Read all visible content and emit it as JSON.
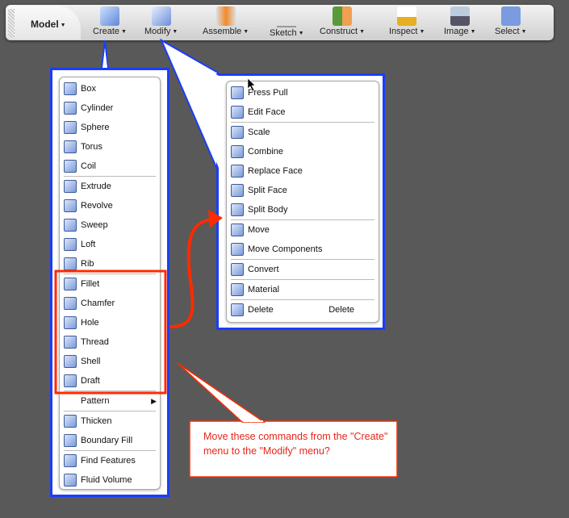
{
  "toolbar": {
    "model_label": "Model",
    "tools": [
      {
        "label": "Create",
        "icon": "box-icon"
      },
      {
        "label": "Modify",
        "icon": "press-pull-icon"
      },
      {
        "label": "Assemble",
        "icon": "assemble-icon"
      },
      {
        "label": "Sketch",
        "icon": "sketch-icon"
      },
      {
        "label": "Construct",
        "icon": "construct-icon"
      },
      {
        "label": "Inspect",
        "icon": "ruler-icon"
      },
      {
        "label": "Image",
        "icon": "image-icon"
      },
      {
        "label": "Select",
        "icon": "cursor-icon"
      }
    ]
  },
  "create_menu": {
    "groups": [
      [
        {
          "label": "Box"
        },
        {
          "label": "Cylinder"
        },
        {
          "label": "Sphere"
        },
        {
          "label": "Torus"
        },
        {
          "label": "Coil"
        }
      ],
      [
        {
          "label": "Extrude"
        },
        {
          "label": "Revolve"
        },
        {
          "label": "Sweep"
        },
        {
          "label": "Loft"
        },
        {
          "label": "Rib"
        }
      ],
      [
        {
          "label": "Fillet"
        },
        {
          "label": "Chamfer"
        },
        {
          "label": "Hole"
        },
        {
          "label": "Thread"
        },
        {
          "label": "Shell"
        },
        {
          "label": "Draft"
        }
      ],
      [
        {
          "label": "Pattern",
          "submenu": true,
          "noicon": true
        }
      ],
      [
        {
          "label": "Thicken"
        },
        {
          "label": "Boundary Fill"
        }
      ],
      [
        {
          "label": "Find Features"
        },
        {
          "label": "Fluid Volume"
        }
      ]
    ]
  },
  "modify_menu": {
    "groups": [
      [
        {
          "label": "Press Pull"
        },
        {
          "label": "Edit Face"
        }
      ],
      [
        {
          "label": "Scale"
        },
        {
          "label": "Combine"
        },
        {
          "label": "Replace Face"
        },
        {
          "label": "Split Face"
        },
        {
          "label": "Split Body"
        }
      ],
      [
        {
          "label": "Move"
        },
        {
          "label": "Move Components"
        }
      ],
      [
        {
          "label": "Convert"
        }
      ],
      [
        {
          "label": "Material"
        }
      ],
      [
        {
          "label": "Delete",
          "shortcut": "Delete"
        }
      ]
    ]
  },
  "annotation": {
    "text": "Move these commands from the \"Create\" menu to the \"Modify\" menu?"
  },
  "colors": {
    "callout_blue": "#1a3dff",
    "highlight_red": "#ff2a00",
    "annotation_text": "#e8261a"
  }
}
